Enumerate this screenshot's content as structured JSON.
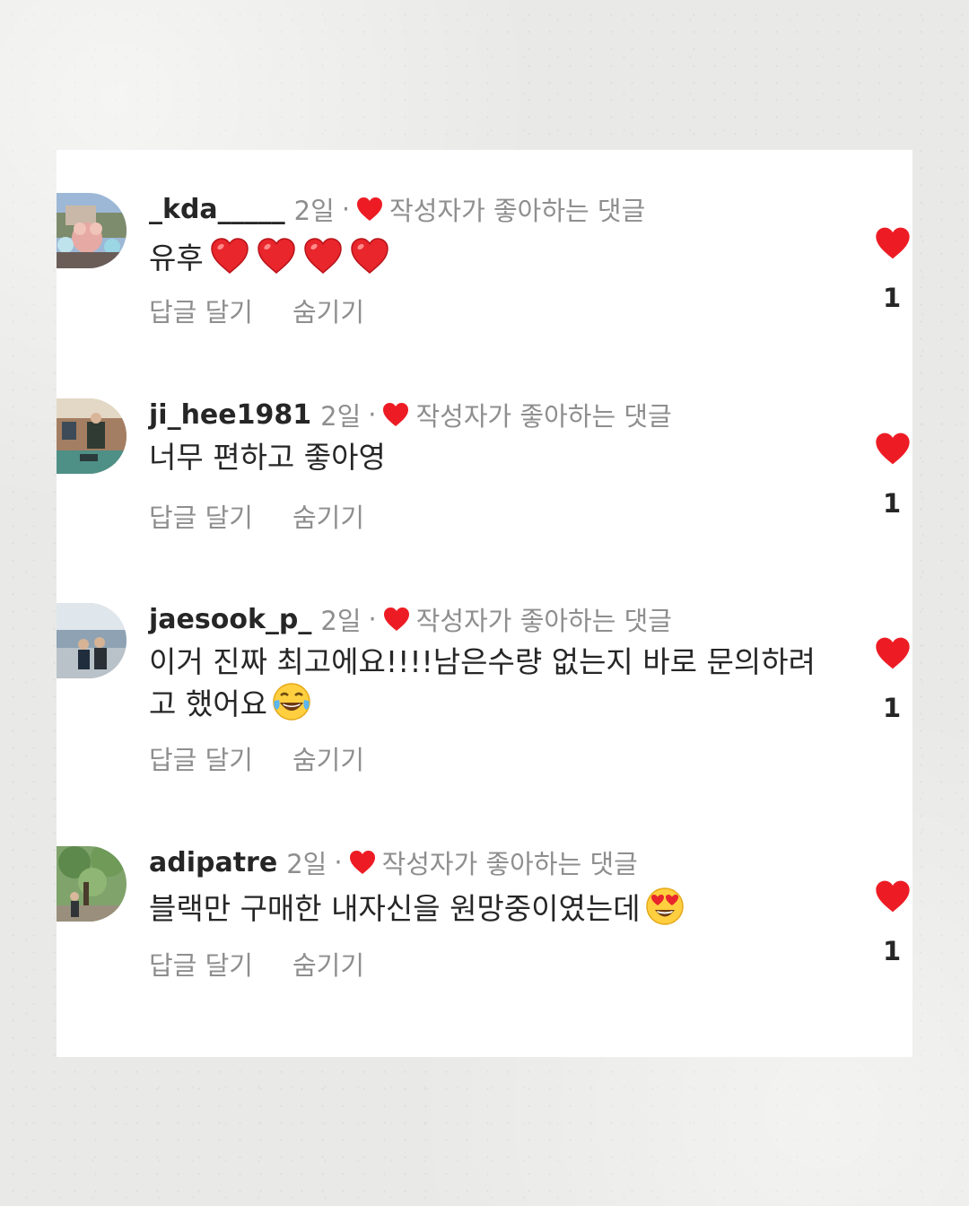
{
  "liked_label": "작성자가 좋아하는 댓글",
  "actions": {
    "reply": "답글 달기",
    "hide": "숨기기"
  },
  "colors": {
    "heart": "#ed1c24",
    "username": "#262626",
    "muted": "#8e8e8e"
  },
  "comments": [
    {
      "username": "_kda_____",
      "time": "2일",
      "text": "유후",
      "emoji": [
        "red-heart",
        "red-heart",
        "red-heart",
        "red-heart"
      ],
      "like_count": "1"
    },
    {
      "username": "ji_hee1981",
      "time": "2일",
      "text": "너무 편하고 좋아영",
      "emoji": [],
      "like_count": "1"
    },
    {
      "username": "jaesook_p_",
      "time": "2일",
      "text": "이거 진짜 최고에요!!!!남은수량 없는지 바로 문의하려고 했어요",
      "emoji": [
        "face-with-tears-of-joy"
      ],
      "like_count": "1"
    },
    {
      "username": "adipatre",
      "time": "2일",
      "text": "블랙만 구매한 내자신을 원망중이였는데",
      "emoji": [
        "smiling-face-with-heart-eyes"
      ],
      "like_count": "1"
    }
  ]
}
